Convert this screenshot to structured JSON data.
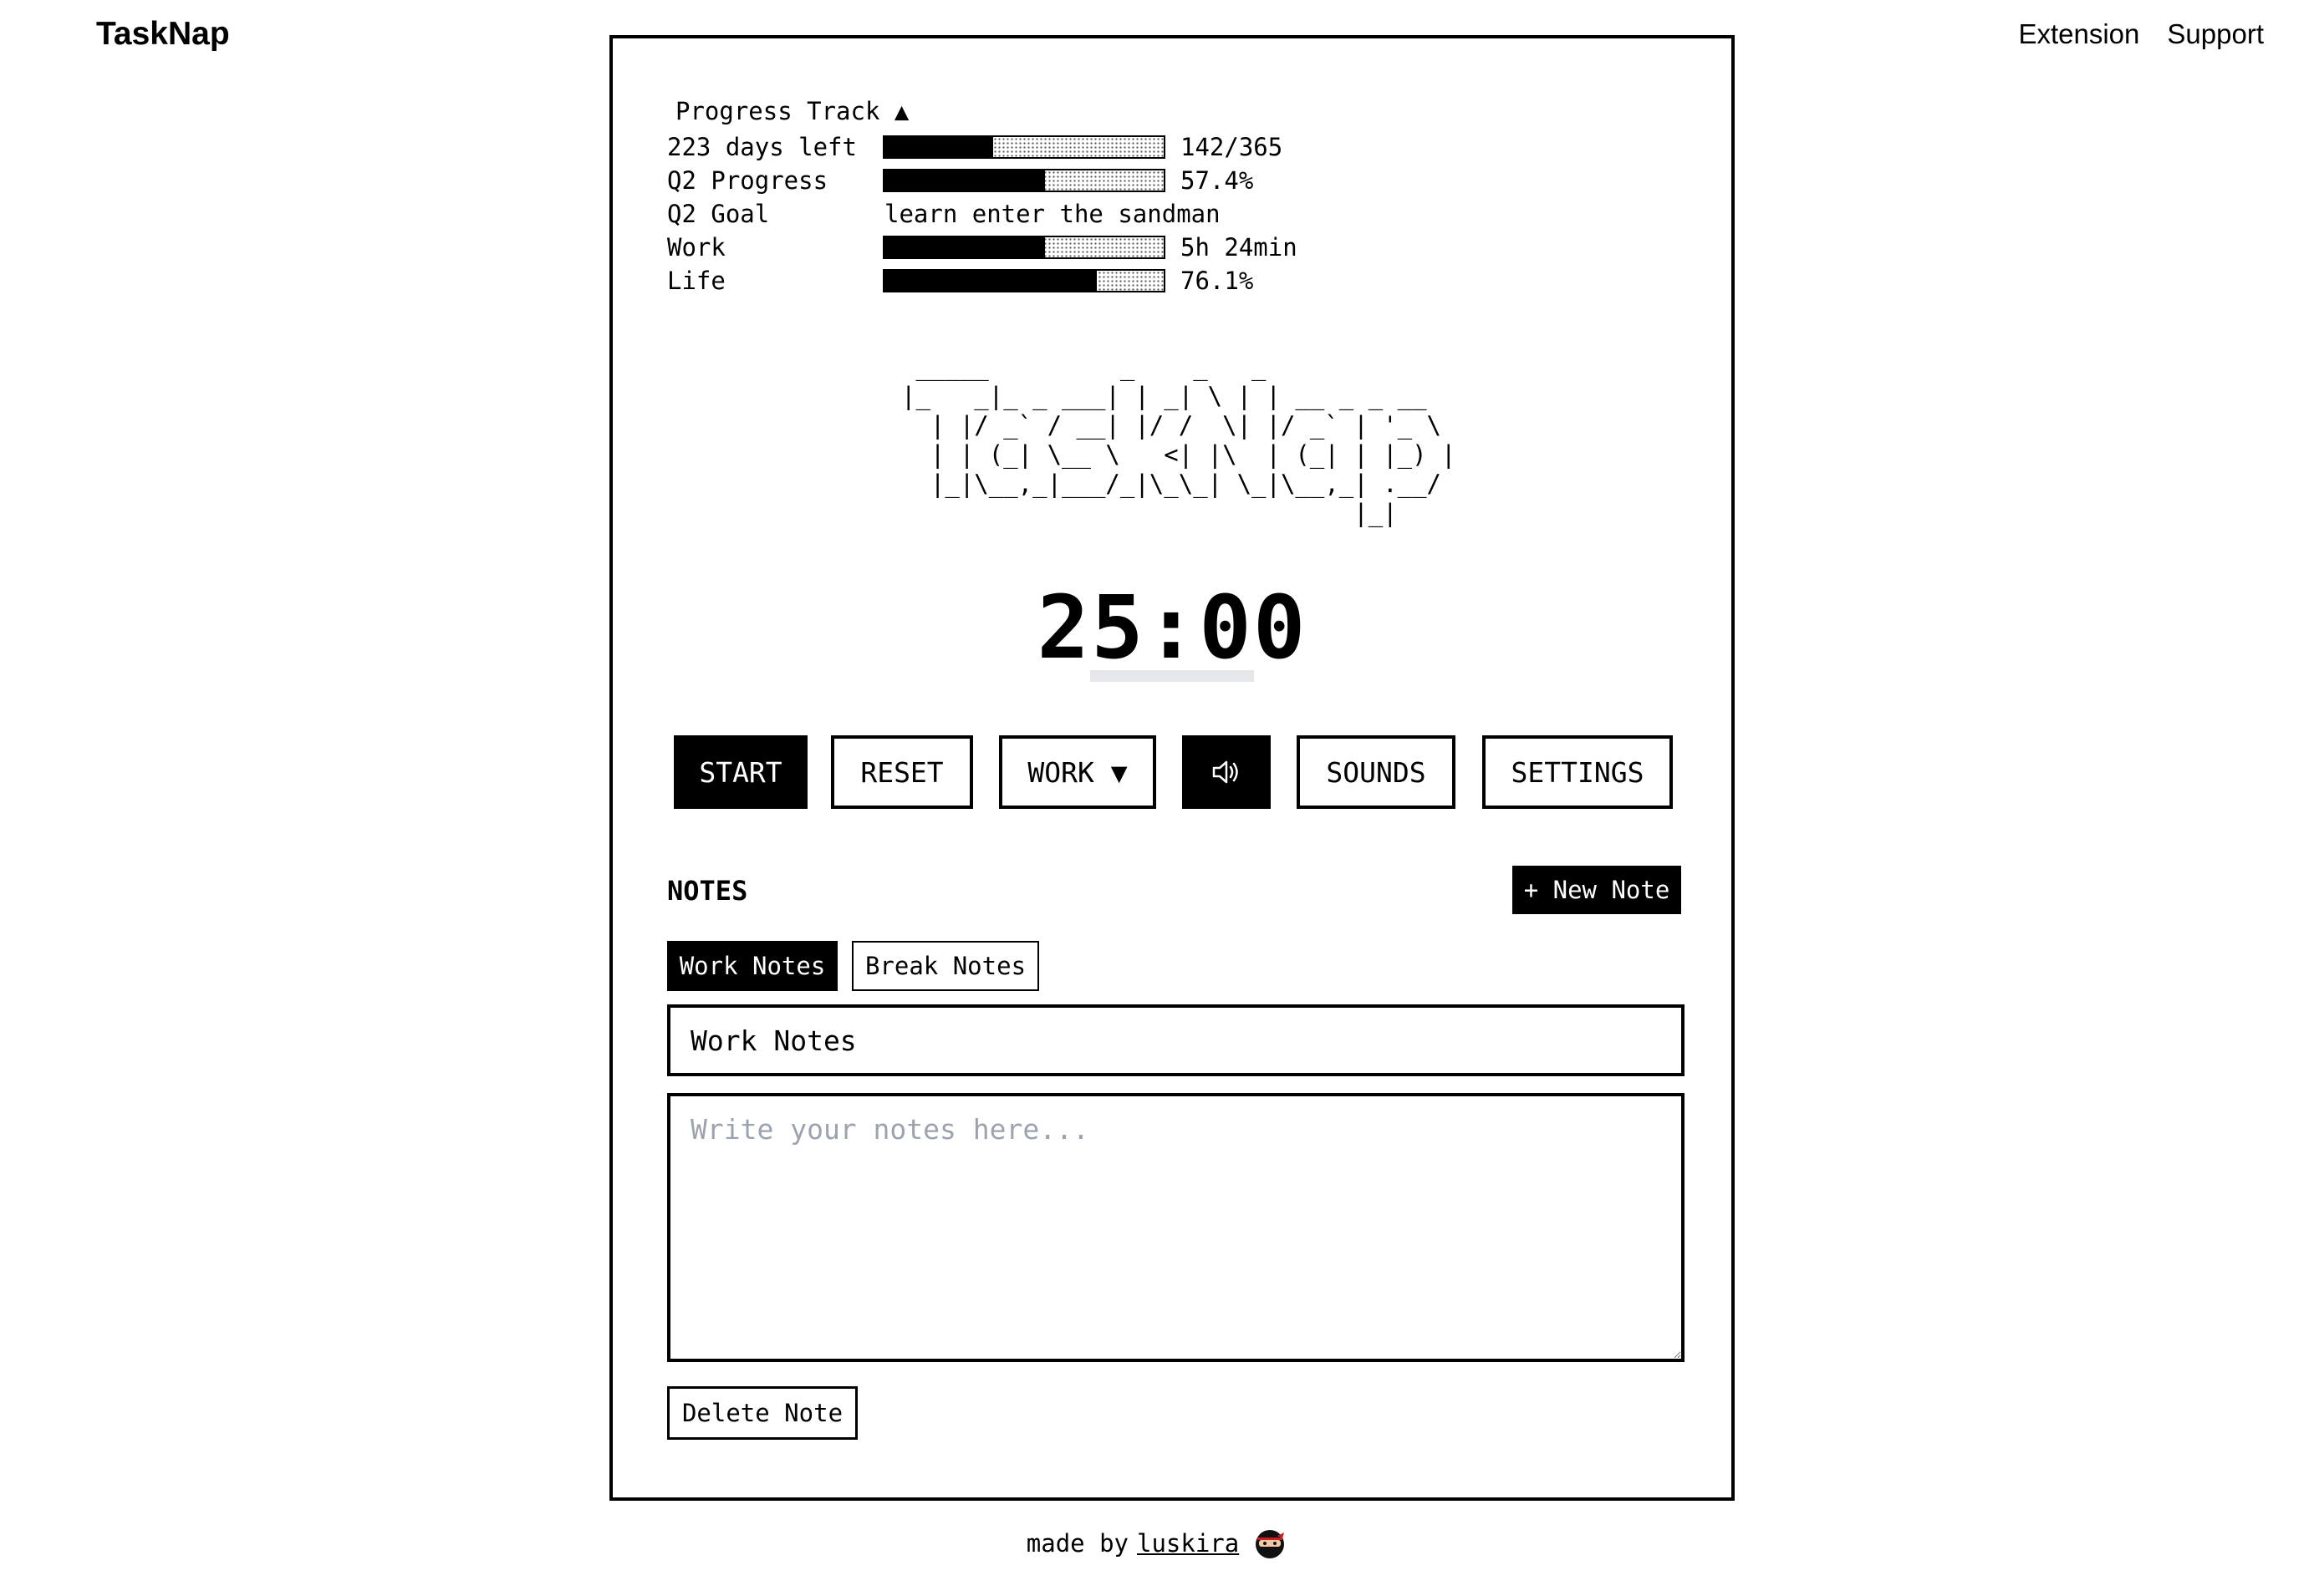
{
  "header": {
    "brand": "TaskNap",
    "nav": [
      "Extension",
      "Support"
    ]
  },
  "progress": {
    "title": "Progress Track ▲",
    "rows": [
      {
        "label": "223 days left",
        "fraction": 0.389,
        "value": "142/365"
      },
      {
        "label": "Q2 Progress",
        "fraction": 0.574,
        "value": "57.4%"
      },
      {
        "label": "Q2 Goal",
        "text": "learn enter the sandman"
      },
      {
        "label": "Work",
        "fraction": 0.574,
        "value": "5h 24min"
      },
      {
        "label": "Life",
        "fraction": 0.761,
        "value": "76.1%"
      }
    ]
  },
  "logo_ascii": " _____         _    _   _             \n|_   _|_ _ ___| | _| \\ | | __ _ _ __  \n  | |/ _` / __| |/ /  \\| |/ _` | '_ \\ \n  | | (_| \\__ \\   <| |\\  | (_| | |_) |\n  |_|\\__,_|___/_|\\_\\_| \\_|\\__,_| .__/ \n                               |_|    ",
  "timer": "25:00",
  "controls": {
    "start": "START",
    "reset": "RESET",
    "mode": "WORK ▼",
    "sound_icon": "speaker-icon",
    "sounds": "SOUNDS",
    "settings": "SETTINGS"
  },
  "notes": {
    "title": "NOTES",
    "new_note": "+ New Note",
    "tabs": [
      "Work Notes",
      "Break Notes"
    ],
    "active_tab": "Work Notes",
    "note_title_value": "Work Notes",
    "placeholder": "Write your notes here...",
    "delete": "Delete Note"
  },
  "footer": {
    "made_by": "made by",
    "author": "luskira",
    "avatar_icon": "ninja-avatar-icon"
  }
}
